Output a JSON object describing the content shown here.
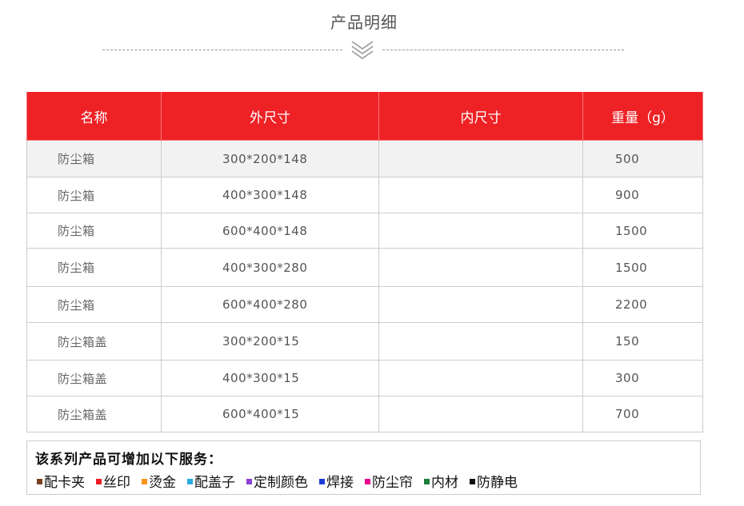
{
  "heading": "产品明细",
  "table": {
    "headers": [
      "名称",
      "外尺寸",
      "内尺寸",
      "重量（g）"
    ],
    "rows": [
      {
        "name": "防尘箱",
        "outer": "300*200*148",
        "inner": "",
        "weight": "500"
      },
      {
        "name": "防尘箱",
        "outer": "400*300*148",
        "inner": "",
        "weight": "900"
      },
      {
        "name": "防尘箱",
        "outer": "600*400*148",
        "inner": "",
        "weight": "1500"
      },
      {
        "name": "防尘箱",
        "outer": "400*300*280",
        "inner": "",
        "weight": "1500"
      },
      {
        "name": "防尘箱",
        "outer": "600*400*280",
        "inner": "",
        "weight": "2200"
      },
      {
        "name": "防尘箱盖",
        "outer": "300*200*15",
        "inner": "",
        "weight": "150"
      },
      {
        "name": "防尘箱盖",
        "outer": "400*300*15",
        "inner": "",
        "weight": "300"
      },
      {
        "name": "防尘箱盖",
        "outer": "600*400*15",
        "inner": "",
        "weight": "700"
      }
    ]
  },
  "services": {
    "title": "该系列产品可增加以下服务：",
    "items": [
      {
        "label": "配卡夹",
        "color": "#7b3f1e"
      },
      {
        "label": "丝印",
        "color": "#ee1c25"
      },
      {
        "label": "烫金",
        "color": "#f7941d"
      },
      {
        "label": "配盖子",
        "color": "#29abe2"
      },
      {
        "label": "定制颜色",
        "color": "#8e3fd6"
      },
      {
        "label": "焊接",
        "color": "#1f3ddb"
      },
      {
        "label": "防尘帘",
        "color": "#ec008c"
      },
      {
        "label": "内材",
        "color": "#1a7f3c"
      },
      {
        "label": "防静电",
        "color": "#111111"
      }
    ]
  },
  "colors": {
    "header_bg": "#ee2125",
    "stripe": "#f2f2f2",
    "border": "#cccccc"
  }
}
